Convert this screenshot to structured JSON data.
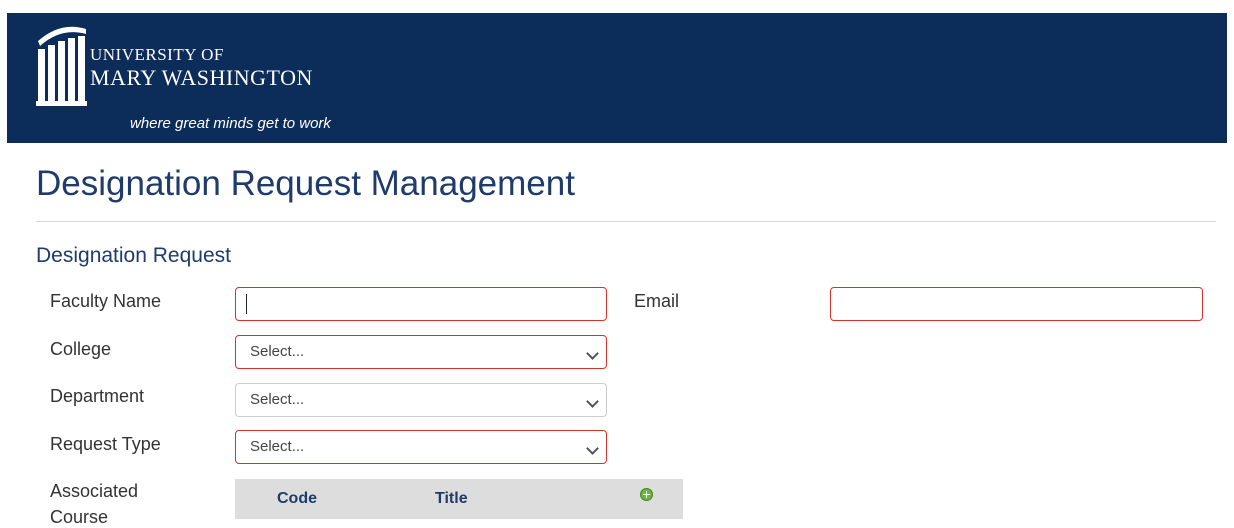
{
  "header": {
    "logo_line1": "UNIVERSITY OF",
    "logo_line2": "MARY WASHINGTON",
    "tagline": "where great minds get to work"
  },
  "page": {
    "title": "Designation Request Management",
    "section_title": "Designation Request"
  },
  "form": {
    "faculty_name": {
      "label": "Faculty Name",
      "value": ""
    },
    "email": {
      "label": "Email",
      "value": ""
    },
    "college": {
      "label": "College",
      "selected": "Select..."
    },
    "department": {
      "label": "Department",
      "selected": "Select..."
    },
    "request_type": {
      "label": "Request Type",
      "selected": "Select..."
    },
    "associated_course": {
      "label_line1": "Associated",
      "label_line2": "Course",
      "columns": [
        "Code",
        "Title"
      ]
    }
  },
  "icons": {
    "add": "plus-circle-icon",
    "dropdown": "chevron-down-icon",
    "logo": "columns-logo-icon"
  },
  "colors": {
    "banner": "#0c2c5a",
    "heading": "#1f3b6b",
    "required_border": "#d0342c",
    "add_icon": "#6cb33f"
  }
}
